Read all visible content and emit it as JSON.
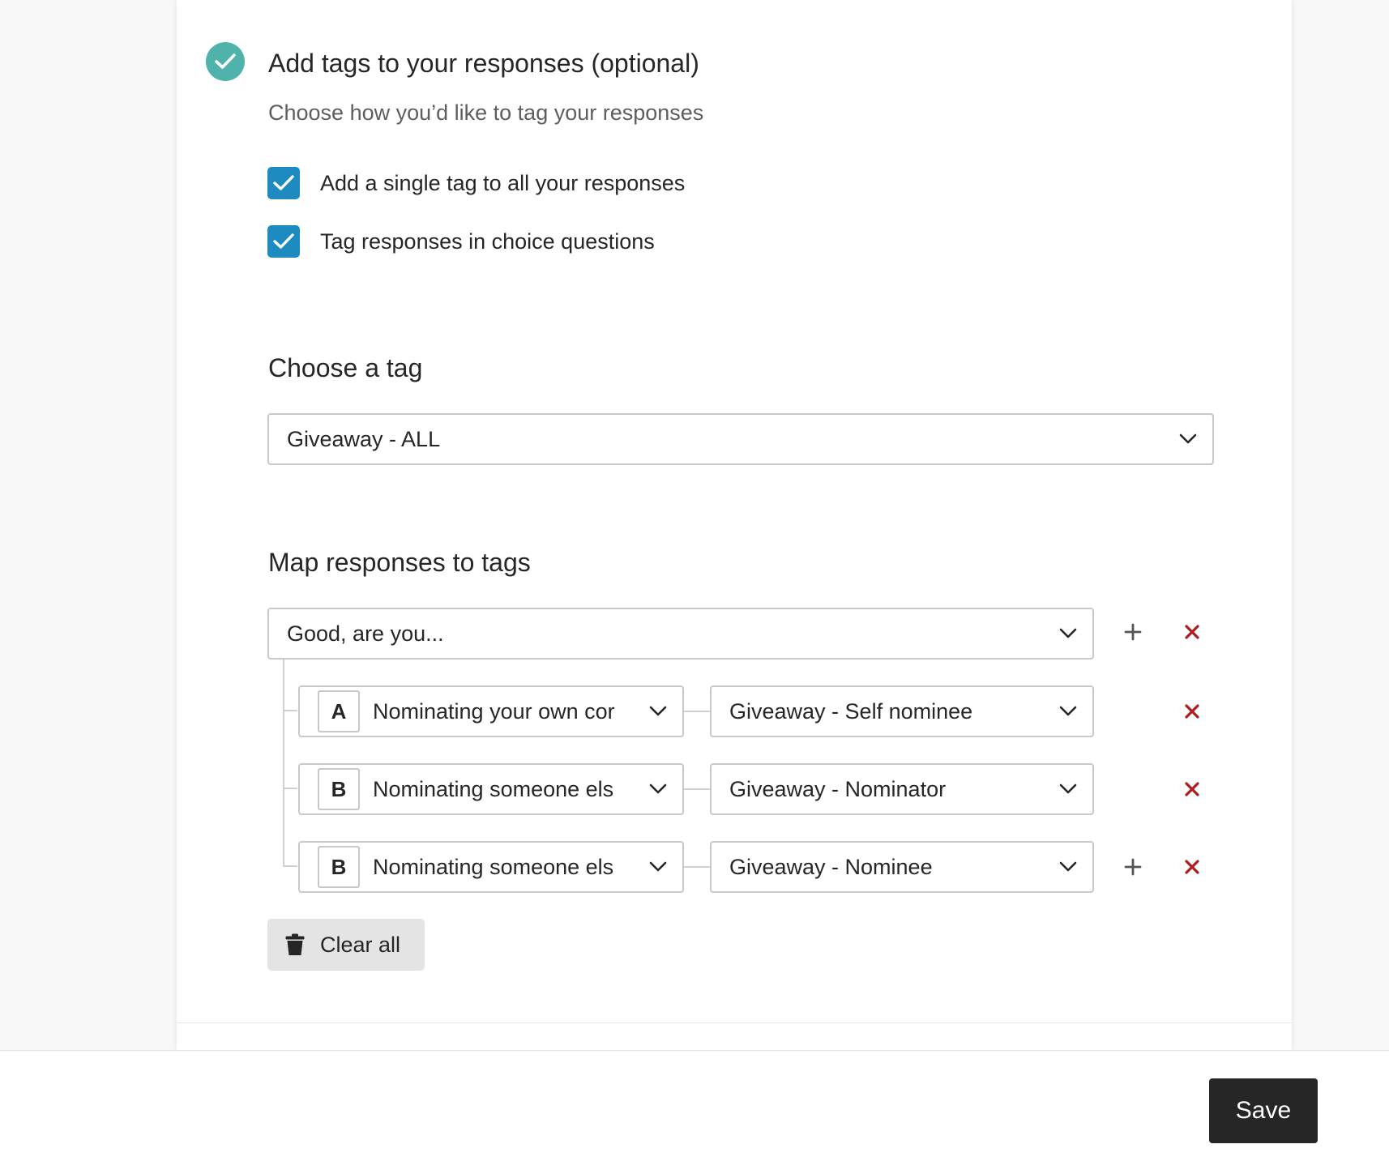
{
  "step": {
    "title": "Add tags to your responses (optional)",
    "subtitle": "Choose how you’d like to tag your responses",
    "status_icon": "check-circle-icon",
    "accent_color": "#4fb2ab"
  },
  "options": {
    "checkbox_color": "#1d8bc0",
    "items": [
      {
        "label": "Add a single tag to all your responses",
        "checked": true
      },
      {
        "label": "Tag responses in choice questions",
        "checked": true
      }
    ]
  },
  "choose_tag": {
    "heading": "Choose a tag",
    "selected": "Giveaway - ALL"
  },
  "mapping": {
    "heading": "Map responses to tags",
    "question": "Good, are you...",
    "rows": [
      {
        "letter": "A",
        "choice": "Nominating your own cor",
        "tag": "Giveaway - Self nominee"
      },
      {
        "letter": "B",
        "choice": "Nominating someone els",
        "tag": "Giveaway - Nominator"
      },
      {
        "letter": "B",
        "choice": "Nominating someone els",
        "tag": "Giveaway - Nominee"
      }
    ],
    "delete_color": "#b01c1c",
    "clear_all_label": "Clear all"
  },
  "footer": {
    "save_label": "Save"
  }
}
